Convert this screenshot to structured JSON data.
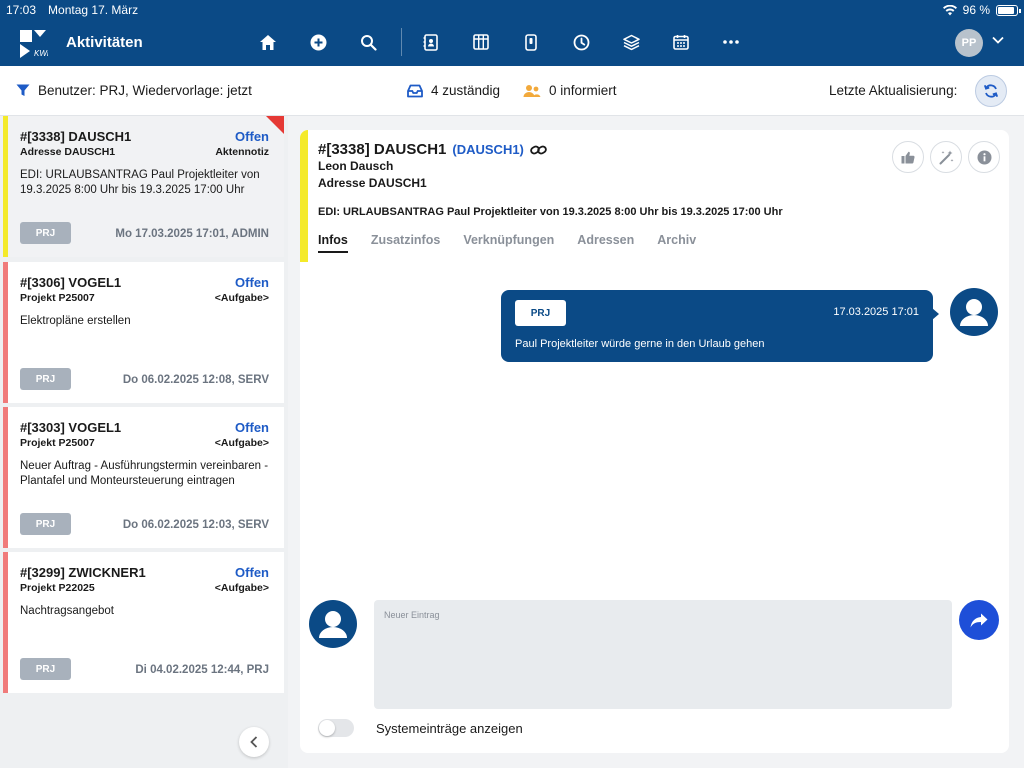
{
  "statusbar": {
    "time": "17:03",
    "date": "Montag 17. März",
    "battery": "96 %"
  },
  "header": {
    "title": "Aktivitäten",
    "user_initials": "PP"
  },
  "filterbar": {
    "filter_text": "Benutzer: PRJ, Wiedervorlage: jetzt",
    "assigned": "4 zuständig",
    "informed": "0 informiert",
    "last_update_label": "Letzte Aktualisierung:"
  },
  "list": {
    "items": [
      {
        "title": "#[3338] DAUSCH1",
        "status": "Offen",
        "sub": "Adresse DAUSCH1",
        "type": "Aktennotiz",
        "desc": "EDI: URLAUBSANTRAG Paul Projektleiter von 19.3.2025 8:00 Uhr bis 19.3.2025 17:00 Uhr",
        "tag": "PRJ",
        "date": "Mo 17.03.2025 17:01, ADMIN"
      },
      {
        "title": "#[3306] VOGEL1",
        "status": "Offen",
        "sub": "Projekt P25007",
        "type": "<Aufgabe>",
        "desc": "Elektropläne erstellen",
        "tag": "PRJ",
        "date": "Do 06.02.2025 12:08, SERV"
      },
      {
        "title": "#[3303] VOGEL1",
        "status": "Offen",
        "sub": "Projekt P25007",
        "type": "<Aufgabe>",
        "desc": "Neuer Auftrag - Ausführungstermin vereinbaren - Plantafel und Monteursteuerung eintragen",
        "tag": "PRJ",
        "date": "Do 06.02.2025 12:03, SERV"
      },
      {
        "title": "#[3299] ZWICKNER1",
        "status": "Offen",
        "sub": "Projekt P22025",
        "type": "<Aufgabe>",
        "desc": "Nachtragsangebot",
        "tag": "PRJ",
        "date": "Di 04.02.2025 12:44, PRJ"
      }
    ]
  },
  "detail": {
    "title": "#[3338] DAUSCH1",
    "ref": "(DAUSCH1)",
    "name": "Leon Dausch",
    "address": "Adresse DAUSCH1",
    "edi": "EDI: URLAUBSANTRAG Paul Projektleiter von 19.3.2025 8:00 Uhr bis 19.3.2025 17:00 Uhr",
    "tabs": [
      "Infos",
      "Zusatzinfos",
      "Verknüpfungen",
      "Adressen",
      "Archiv"
    ],
    "message": {
      "tag": "PRJ",
      "time": "17.03.2025 17:01",
      "text": "Paul Projektleiter würde gerne in den Urlaub gehen"
    },
    "composer_placeholder": "Neuer Eintrag",
    "system_entries_label": "Systemeinträge anzeigen"
  },
  "colors": {
    "primary": "#0b4a86",
    "accent_blue": "#1e5bc6",
    "selected_bar": "#f4ea2a",
    "open_bar": "#f07b7b",
    "send": "#1e4fd8"
  }
}
